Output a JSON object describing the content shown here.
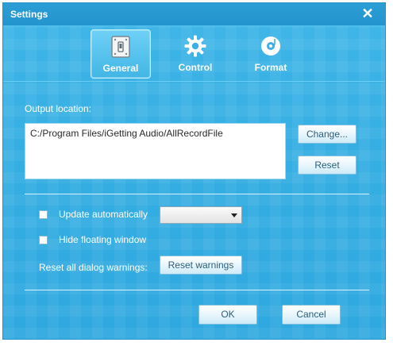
{
  "window": {
    "title": "Settings",
    "close_glyph": "✕"
  },
  "tabs": [
    {
      "label": "General",
      "icon": "general-icon",
      "active": true
    },
    {
      "label": "Control",
      "icon": "gear-icon",
      "active": false
    },
    {
      "label": "Format",
      "icon": "music-disc-icon",
      "active": false
    }
  ],
  "output": {
    "label": "Output location:",
    "path": "C:/Program Files/iGetting Audio/AllRecordFile",
    "change_button": "Change...",
    "reset_button": "Reset"
  },
  "options": {
    "update_auto_label": "Update automatically",
    "update_auto_checked": false,
    "update_interval_value": "",
    "hide_floating_label": "Hide floating window",
    "hide_floating_checked": false,
    "reset_warnings_label": "Reset all dialog warnings:",
    "reset_warnings_button": "Reset warnings"
  },
  "footer": {
    "ok_button": "OK",
    "cancel_button": "Cancel"
  },
  "colors": {
    "accent": "#35aee3",
    "titlebar": "#2394cd"
  }
}
